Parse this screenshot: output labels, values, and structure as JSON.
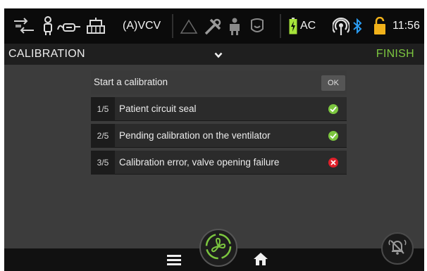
{
  "statusbar": {
    "icons": [
      "ventilation-mode-icon",
      "patient-icon",
      "circuit-icon",
      "humidifier-icon"
    ],
    "mode": "(A)VCV",
    "alarm_icons": [
      "alarm-triangle-icon",
      "tools-icon",
      "person-ventilator-icon",
      "face-mask-icon"
    ],
    "battery_label": "AC",
    "connectivity_icons": [
      "wifi-signal-icon",
      "bluetooth-icon",
      "unlock-icon"
    ],
    "time": "11:56"
  },
  "titlebar": {
    "title": "CALIBRATION",
    "finish_label": "FINISH"
  },
  "calibration": {
    "start_label": "Start a calibration",
    "ok_label": "OK",
    "steps": [
      {
        "index": "1/5",
        "label": "Patient circuit seal",
        "status": "success"
      },
      {
        "index": "2/5",
        "label": "Pending calibration on the ventilator",
        "status": "success"
      },
      {
        "index": "3/5",
        "label": "Calibration error, valve opening failure",
        "status": "error"
      }
    ]
  },
  "colors": {
    "accent_green": "#7cc63f",
    "success": "#7cc63f",
    "error": "#e0202a",
    "battery": "#a6e33a",
    "lock": "#f2b21a",
    "bluetooth": "#2a9df4"
  },
  "bottombar": {
    "icons": [
      "menu-icon",
      "fan-icon",
      "home-icon",
      "alarm-bell-icon"
    ]
  }
}
